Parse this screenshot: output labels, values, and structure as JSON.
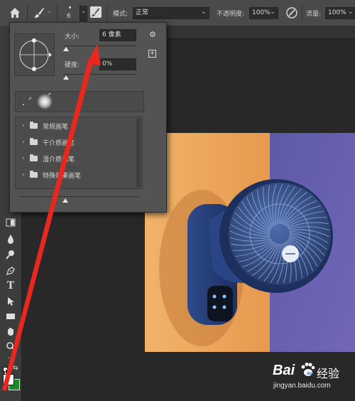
{
  "options_bar": {
    "brush_size_value": "6",
    "mode_label": "模式:",
    "mode_value": "正常",
    "opacity_label": "不透明度:",
    "opacity_value": "100%",
    "flow_label": "流量:",
    "flow_value": "100%"
  },
  "brush_panel": {
    "size_label": "大小:",
    "size_value": "6 像素",
    "hardness_label": "硬度:",
    "hardness_value": "0%",
    "folders": [
      {
        "label": "常规画笔"
      },
      {
        "label": "干介质画笔"
      },
      {
        "label": "湿介质画笔"
      },
      {
        "label": "特殊效果画笔"
      }
    ]
  },
  "tools": [
    {
      "name": "move-tool-icon"
    },
    {
      "name": "gradient-tool-icon"
    },
    {
      "name": "blur-tool-icon"
    },
    {
      "name": "dodge-tool-icon"
    },
    {
      "name": "pen-tool-icon"
    },
    {
      "name": "type-tool-icon",
      "glyph": "T"
    },
    {
      "name": "path-selection-tool-icon"
    },
    {
      "name": "rectangle-tool-icon"
    },
    {
      "name": "hand-tool-icon"
    },
    {
      "name": "zoom-tool-icon"
    },
    {
      "name": "more-tools-icon",
      "glyph": "···"
    }
  ],
  "colors": {
    "foreground": "#ffffff",
    "background": "#1a8a2a",
    "annotation_arrow": "#e8281e",
    "panel": "#535353",
    "options_bar": "#4a4a4a"
  },
  "watermark": {
    "logo_text": "Bai",
    "logo_text2": "经验",
    "url": "jingyan.baidu.com"
  }
}
